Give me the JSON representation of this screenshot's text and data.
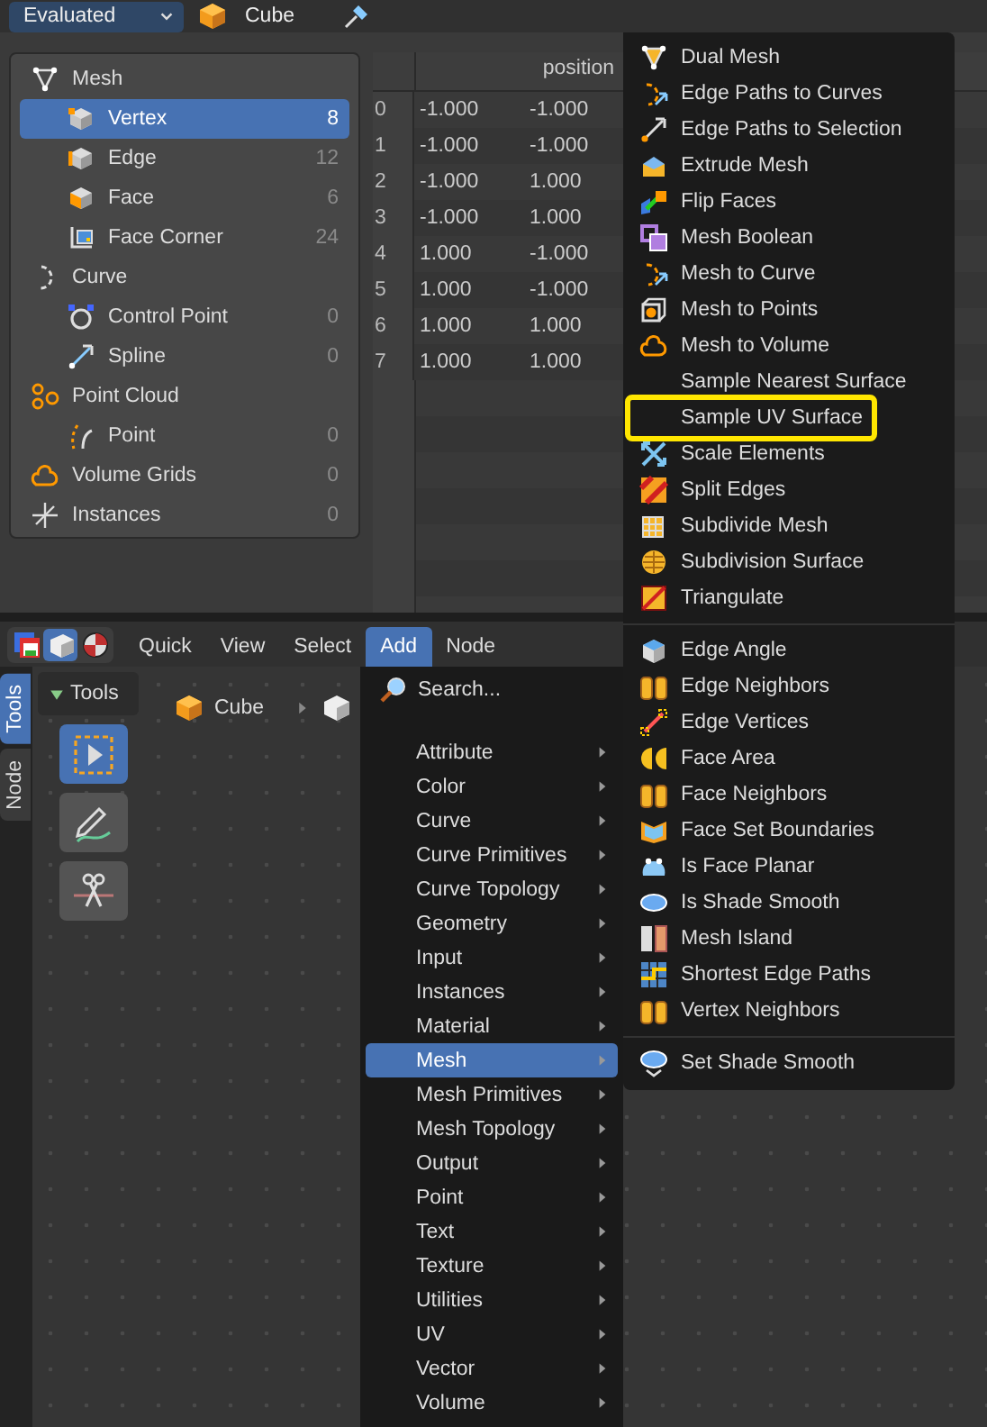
{
  "spreadsheet_header": {
    "display_mode": "Evaluated",
    "object": "Cube"
  },
  "dataset_tree": [
    {
      "label": "Mesh",
      "selected": false,
      "children": [
        {
          "label": "Vertex",
          "count": "8",
          "selected": true
        },
        {
          "label": "Edge",
          "count": "12",
          "selected": false
        },
        {
          "label": "Face",
          "count": "6",
          "selected": false
        },
        {
          "label": "Face Corner",
          "count": "24",
          "selected": false
        }
      ]
    },
    {
      "label": "Curve",
      "selected": false,
      "children": [
        {
          "label": "Control Point",
          "count": "0",
          "selected": false
        },
        {
          "label": "Spline",
          "count": "0",
          "selected": false
        }
      ]
    },
    {
      "label": "Point Cloud",
      "selected": false,
      "children": [
        {
          "label": "Point",
          "count": "0",
          "selected": false
        }
      ]
    },
    {
      "label": "Volume Grids",
      "count": "0",
      "selected": false
    },
    {
      "label": "Instances",
      "count": "0",
      "selected": false
    }
  ],
  "table": {
    "columns": [
      "position"
    ],
    "rows": [
      {
        "index": "0",
        "values": [
          "-1.000",
          "-1.000"
        ]
      },
      {
        "index": "1",
        "values": [
          "-1.000",
          "-1.000"
        ]
      },
      {
        "index": "2",
        "values": [
          "-1.000",
          "1.000"
        ]
      },
      {
        "index": "3",
        "values": [
          "-1.000",
          "1.000"
        ]
      },
      {
        "index": "4",
        "values": [
          "1.000",
          "-1.000"
        ]
      },
      {
        "index": "5",
        "values": [
          "1.000",
          "-1.000"
        ]
      },
      {
        "index": "6",
        "values": [
          "1.000",
          "1.000"
        ]
      },
      {
        "index": "7",
        "values": [
          "1.000",
          "1.000"
        ]
      }
    ]
  },
  "node_editor": {
    "view_modes": [
      {
        "selected": false
      },
      {
        "selected": true
      },
      {
        "selected": false
      }
    ],
    "menus": [
      {
        "label": "Quick",
        "selected": false
      },
      {
        "label": "View",
        "selected": false
      },
      {
        "label": "Select",
        "selected": false
      },
      {
        "label": "Add",
        "selected": true
      },
      {
        "label": "Node",
        "selected": false
      }
    ],
    "side_tabs": [
      {
        "label": "Tools",
        "selected": true
      },
      {
        "label": "Node",
        "selected": false
      }
    ],
    "tools_panel": {
      "title": "Tools",
      "tools": [
        {
          "selected": true
        },
        {
          "selected": false
        },
        {
          "selected": false
        }
      ]
    },
    "breadcrumb": {
      "object": "Cube"
    }
  },
  "add_menu": {
    "search": "Search...",
    "items": [
      {
        "label": "Attribute",
        "selected": false
      },
      {
        "label": "Color",
        "selected": false
      },
      {
        "label": "Curve",
        "selected": false
      },
      {
        "label": "Curve Primitives",
        "selected": false
      },
      {
        "label": "Curve Topology",
        "selected": false
      },
      {
        "label": "Geometry",
        "selected": false
      },
      {
        "label": "Input",
        "selected": false
      },
      {
        "label": "Instances",
        "selected": false
      },
      {
        "label": "Material",
        "selected": false
      },
      {
        "label": "Mesh",
        "selected": true
      },
      {
        "label": "Mesh Primitives",
        "selected": false
      },
      {
        "label": "Mesh Topology",
        "selected": false
      },
      {
        "label": "Output",
        "selected": false
      },
      {
        "label": "Point",
        "selected": false
      },
      {
        "label": "Text",
        "selected": false
      },
      {
        "label": "Texture",
        "selected": false
      },
      {
        "label": "Utilities",
        "selected": false
      },
      {
        "label": "UV",
        "selected": false
      },
      {
        "label": "Vector",
        "selected": false
      },
      {
        "label": "Volume",
        "selected": false
      }
    ]
  },
  "mesh_submenu": {
    "groups": [
      [
        {
          "label": "Dual Mesh",
          "outlined": false
        },
        {
          "label": "Edge Paths to Curves",
          "outlined": false
        },
        {
          "label": "Edge Paths to Selection",
          "outlined": false
        },
        {
          "label": "Extrude Mesh",
          "outlined": false
        },
        {
          "label": "Flip Faces",
          "outlined": false
        },
        {
          "label": "Mesh Boolean",
          "outlined": false
        },
        {
          "label": "Mesh to Curve",
          "outlined": false
        },
        {
          "label": "Mesh to Points",
          "outlined": false
        },
        {
          "label": "Mesh to Volume",
          "outlined": false
        },
        {
          "label": "Sample Nearest Surface",
          "outlined": false
        },
        {
          "label": "Sample UV Surface",
          "outlined": true
        },
        {
          "label": "Scale Elements",
          "outlined": false
        },
        {
          "label": "Split Edges",
          "outlined": false
        },
        {
          "label": "Subdivide Mesh",
          "outlined": false
        },
        {
          "label": "Subdivision Surface",
          "outlined": false
        },
        {
          "label": "Triangulate",
          "outlined": false
        }
      ],
      [
        {
          "label": "Edge Angle",
          "outlined": false
        },
        {
          "label": "Edge Neighbors",
          "outlined": false
        },
        {
          "label": "Edge Vertices",
          "outlined": false
        },
        {
          "label": "Face Area",
          "outlined": false
        },
        {
          "label": "Face Neighbors",
          "outlined": false
        },
        {
          "label": "Face Set Boundaries",
          "outlined": false
        },
        {
          "label": "Is Face Planar",
          "outlined": false
        },
        {
          "label": "Is Shade Smooth",
          "outlined": false
        },
        {
          "label": "Mesh Island",
          "outlined": false
        },
        {
          "label": "Shortest Edge Paths",
          "outlined": false
        },
        {
          "label": "Vertex Neighbors",
          "outlined": false
        }
      ],
      [
        {
          "label": "Set Shade Smooth",
          "outlined": false
        }
      ]
    ]
  }
}
